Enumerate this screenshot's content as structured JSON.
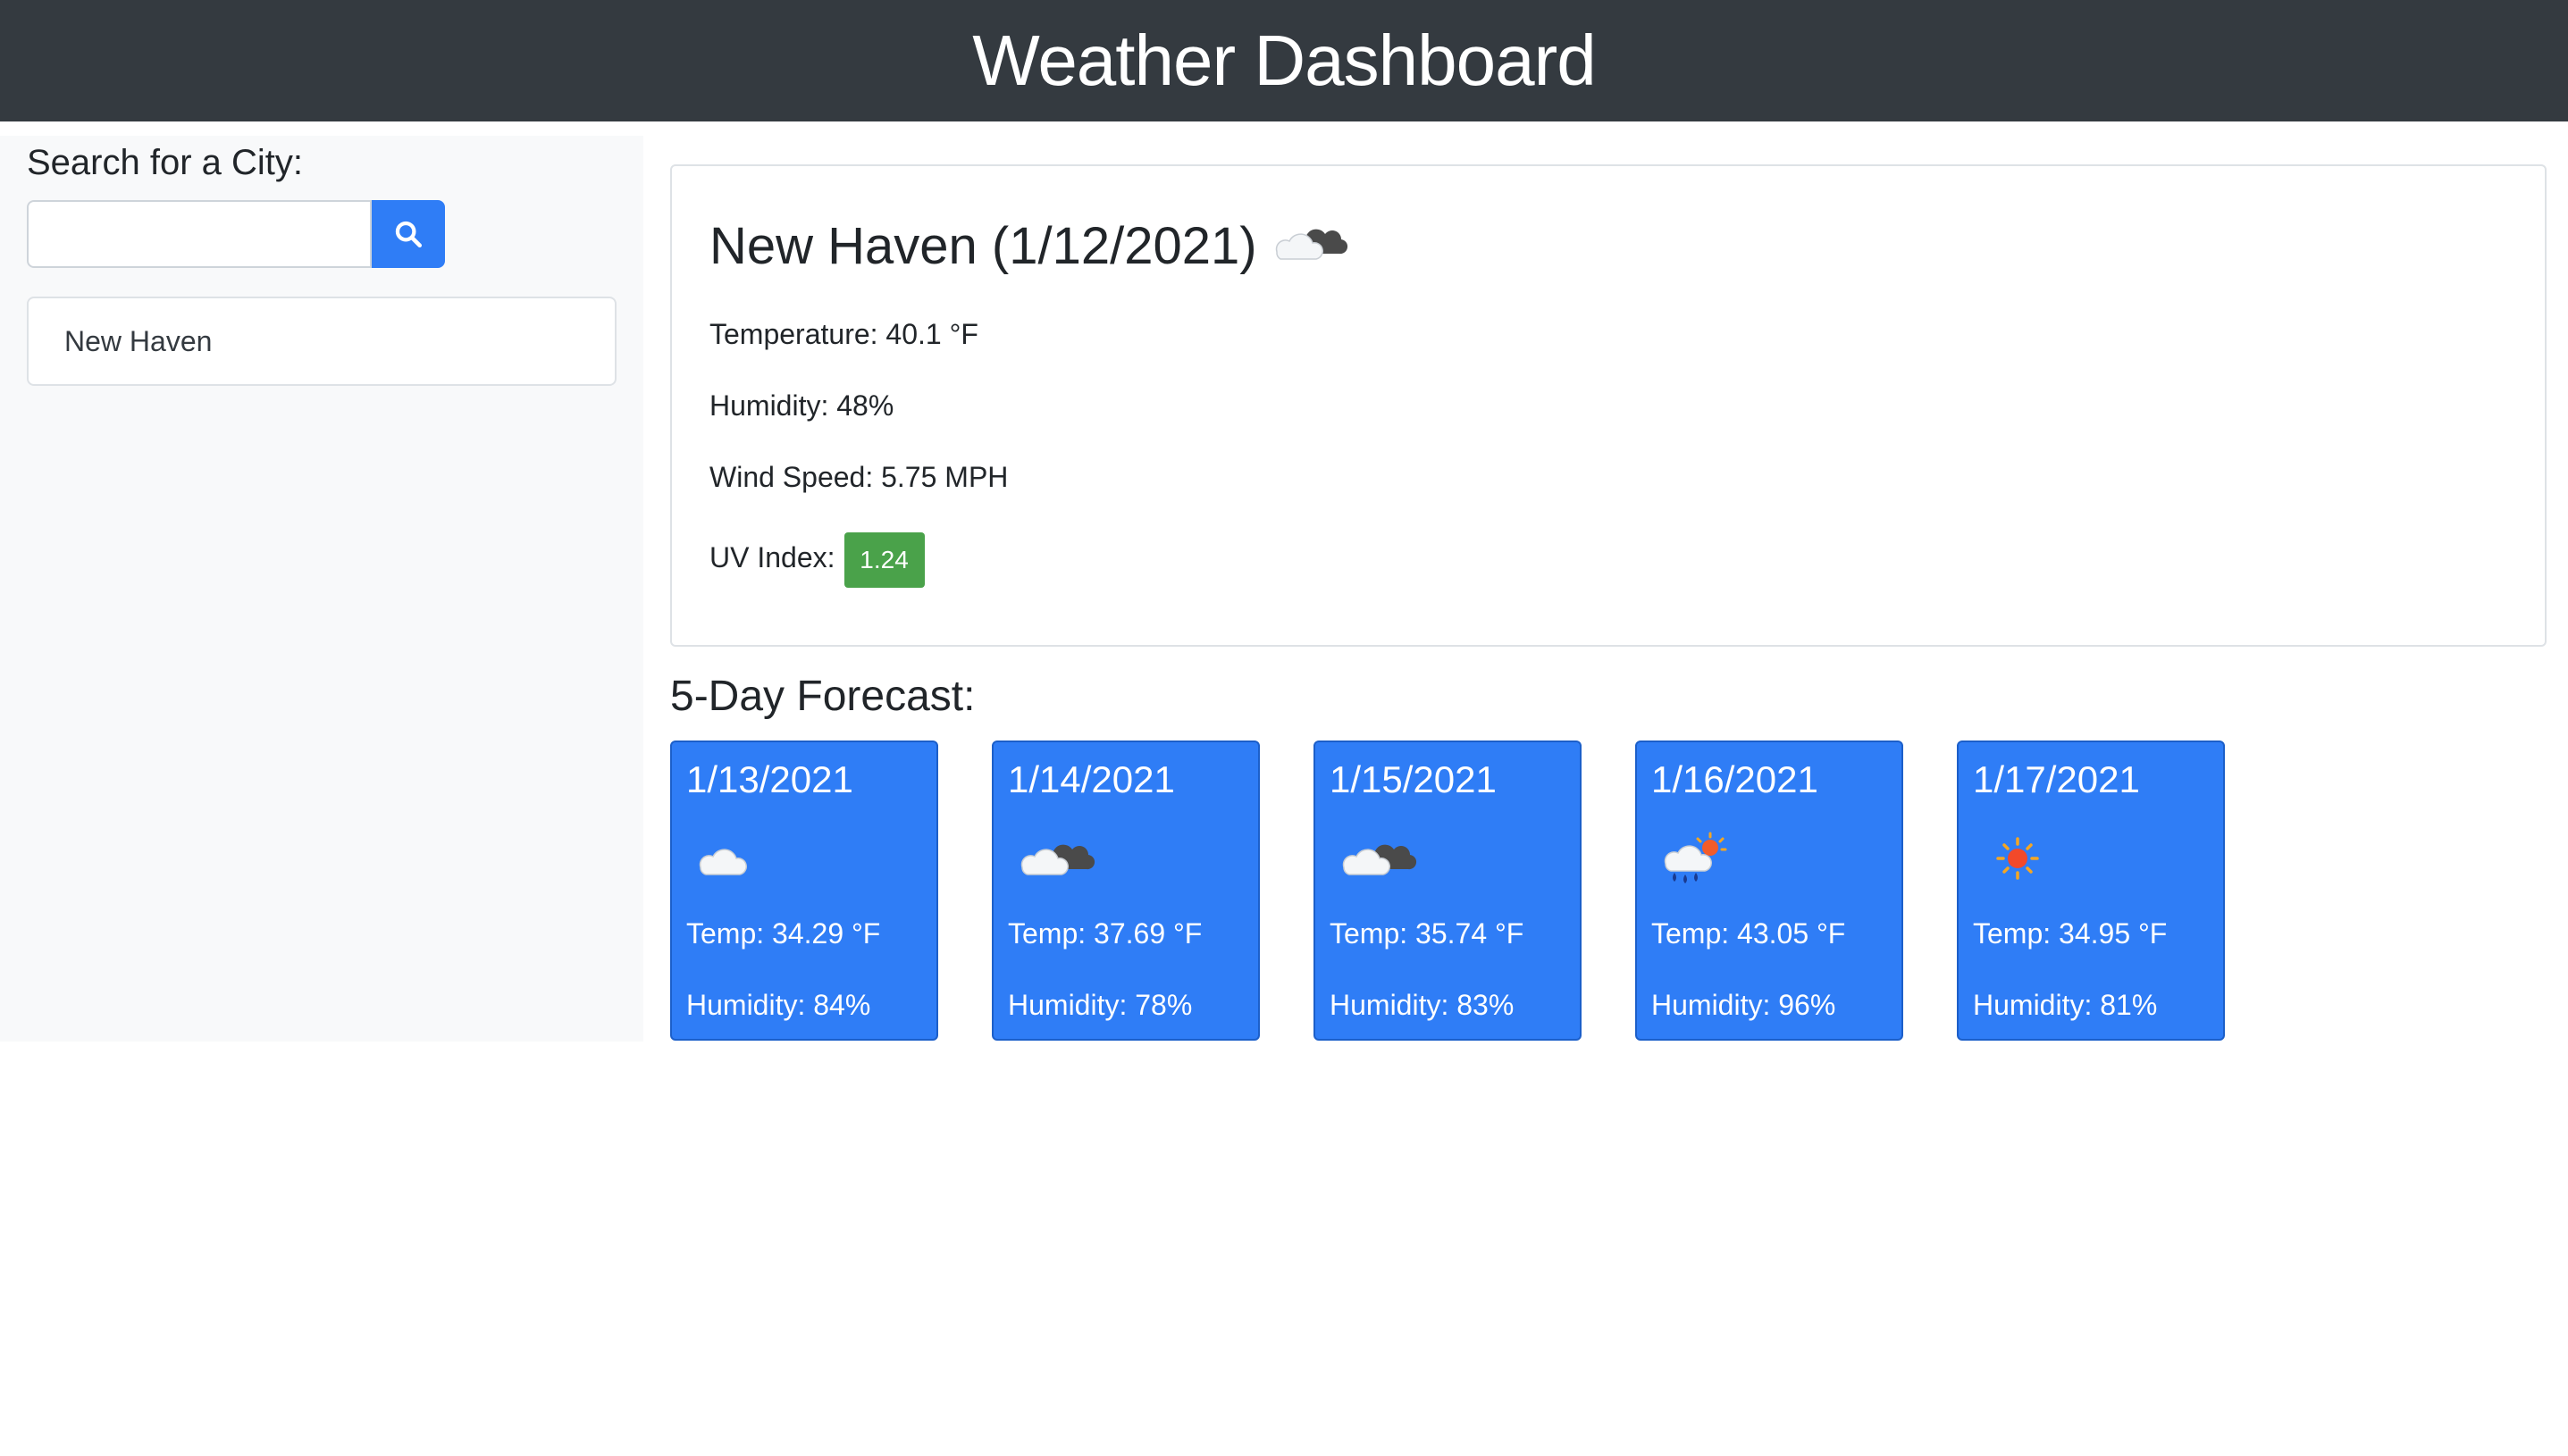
{
  "header": {
    "title": "Weather Dashboard"
  },
  "sidebar": {
    "title": "Search for a City:",
    "search": {
      "value": "",
      "placeholder": "",
      "button_icon": "search-icon"
    },
    "history": [
      {
        "label": "New Haven"
      }
    ]
  },
  "current": {
    "title": "New Haven (1/12/2021)",
    "icon": "clouds-icon",
    "temperature": "Temperature: 40.1 °F",
    "humidity": "Humidity: 48%",
    "wind": "Wind Speed: 5.75 MPH",
    "uv_label": "UV Index:",
    "uv_value": "1.24",
    "uv_color": "#4aa24a"
  },
  "forecast": {
    "title": "5-Day Forecast:",
    "days": [
      {
        "date": "1/13/2021",
        "icon": "cloud-icon",
        "temp": "Temp: 34.29 °F",
        "humidity": "Humidity: 84%"
      },
      {
        "date": "1/14/2021",
        "icon": "clouds-icon",
        "temp": "Temp: 37.69 °F",
        "humidity": "Humidity: 78%"
      },
      {
        "date": "1/15/2021",
        "icon": "clouds-icon",
        "temp": "Temp: 35.74 °F",
        "humidity": "Humidity: 83%"
      },
      {
        "date": "1/16/2021",
        "icon": "rain-sun-icon",
        "temp": "Temp: 43.05 °F",
        "humidity": "Humidity: 96%"
      },
      {
        "date": "1/17/2021",
        "icon": "sun-icon",
        "temp": "Temp: 34.95 °F",
        "humidity": "Humidity: 81%"
      }
    ]
  },
  "colors": {
    "header_bg": "#343a40",
    "accent": "#2f7df6",
    "sidebar_bg": "#f8f9fa"
  }
}
